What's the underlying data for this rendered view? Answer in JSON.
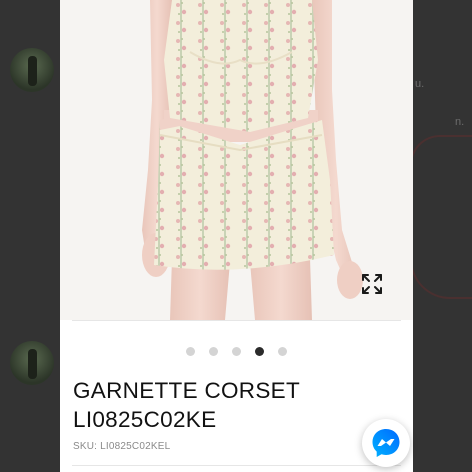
{
  "product": {
    "title_line1": "GARNETTE CORSET",
    "title_line2": "LI0825C02KE",
    "sku_label": "SKU:",
    "sku_value": "LI0825C02KEL"
  },
  "gallery": {
    "slide_count": 5,
    "active_slide": 4
  },
  "background": {
    "fragment_1": "u.",
    "fragment_2": "n."
  },
  "icons": {
    "expand": "expand-icon",
    "messenger": "messenger-icon"
  },
  "colors": {
    "messenger_gradient_start": "#00B2FF",
    "messenger_gradient_end": "#006AFF",
    "active_dot": "#2b2b2b",
    "inactive_dot": "#d4d4d4"
  }
}
